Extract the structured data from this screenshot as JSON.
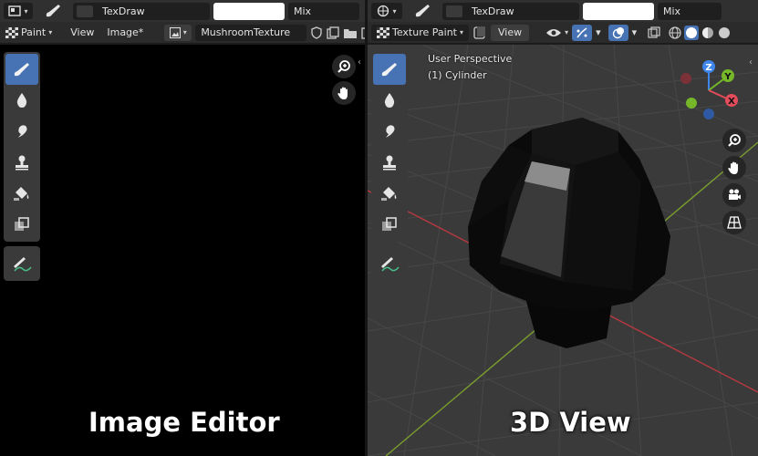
{
  "image_editor": {
    "brush_name": "TexDraw",
    "blend_mode": "Mix",
    "mode_label": "Paint",
    "menu_view": "View",
    "menu_image": "Image*",
    "texture_name": "MushroomTexture",
    "caption": "Image Editor"
  },
  "view_3d": {
    "brush_name": "TexDraw",
    "blend_mode": "Mix",
    "mode_label": "Texture Paint",
    "menu_view": "View",
    "perspective_label": "User Perspective",
    "object_label": "(1) Cylinder",
    "caption": "3D View",
    "gizmo": {
      "x": "X",
      "y": "Y",
      "z": "Z"
    }
  },
  "colors": {
    "accent": "#4772b3",
    "axis_x": "#e34c5a",
    "axis_y": "#76b72a",
    "axis_z": "#3f86ea",
    "grid_red": "#b8393f",
    "grid_green": "#7a9e2e"
  }
}
